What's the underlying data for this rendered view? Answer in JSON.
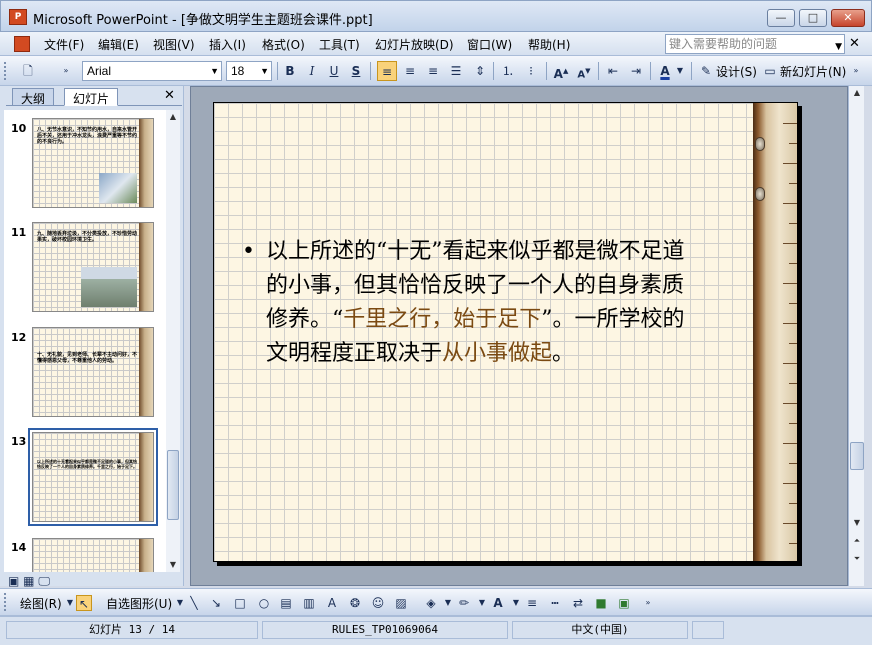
{
  "window": {
    "title": "Microsoft PowerPoint - [争做文明学生主题班会课件.ppt]",
    "app_icon_label": "P",
    "buttons": {
      "minimize": "—",
      "maximize": "□",
      "close": "✕"
    }
  },
  "menubar": {
    "items": [
      "文件(F)",
      "编辑(E)",
      "视图(V)",
      "插入(I)",
      "格式(O)",
      "工具(T)",
      "幻灯片放映(D)",
      "窗口(W)",
      "帮助(H)"
    ],
    "help_placeholder": "键入需要帮助的问题",
    "close_label": "✕"
  },
  "toolbar": {
    "font_name": "Arial",
    "font_size": "18",
    "bold": "B",
    "italic": "I",
    "underline": "U",
    "shadow": "S",
    "design_label": "设计(S)",
    "new_slide_label": "新幻灯片(N)"
  },
  "left_panel": {
    "tabs": [
      "大纲",
      "幻灯片"
    ],
    "close_label": "✕",
    "slides": [
      {
        "number": "10",
        "text": "八、无节水意识，不知节约用水，自来水管开后不关，还用于冲水龙头，浪费严重等不节约的不良行为。"
      },
      {
        "number": "11",
        "text": "九、随地丢弃垃圾，不分类投放，不珍惜劳动果实，破坏校园环境卫生。"
      },
      {
        "number": "12",
        "text": "十、无礼貌，见到老师、长辈不主动问好，不懂得感恩父母，不尊重他人的劳动。"
      },
      {
        "number": "13",
        "text": "以上所述的十无看起来似乎都是微不足道的小事，但其恰恰反映了一个人的自身素质修养。千里之行，始于足下。"
      },
      {
        "number": "14",
        "text": ""
      }
    ]
  },
  "slide": {
    "bullet": "•",
    "segments": [
      {
        "text": "以上所述的“十无”看起来似乎都是微不足道的小事，但其恰恰反映了一个人的自身素质修养。“",
        "highlight": false
      },
      {
        "text": "千里之行，始于足下",
        "highlight": true
      },
      {
        "text": "”。一所学校的文明程度正取决于",
        "highlight": false
      },
      {
        "text": "从小事做起",
        "highlight": true
      },
      {
        "text": "。",
        "highlight": false
      }
    ],
    "text_color": "#000000",
    "highlight_color": "#7b4a12"
  },
  "drawbar": {
    "draw_label": "绘图(R)",
    "autoshape_label": "自选图形(U)"
  },
  "statusbar": {
    "slide_info": "幻灯片 13 / 14",
    "template": "RULES_TP01069064",
    "language": "中文(中国)"
  }
}
